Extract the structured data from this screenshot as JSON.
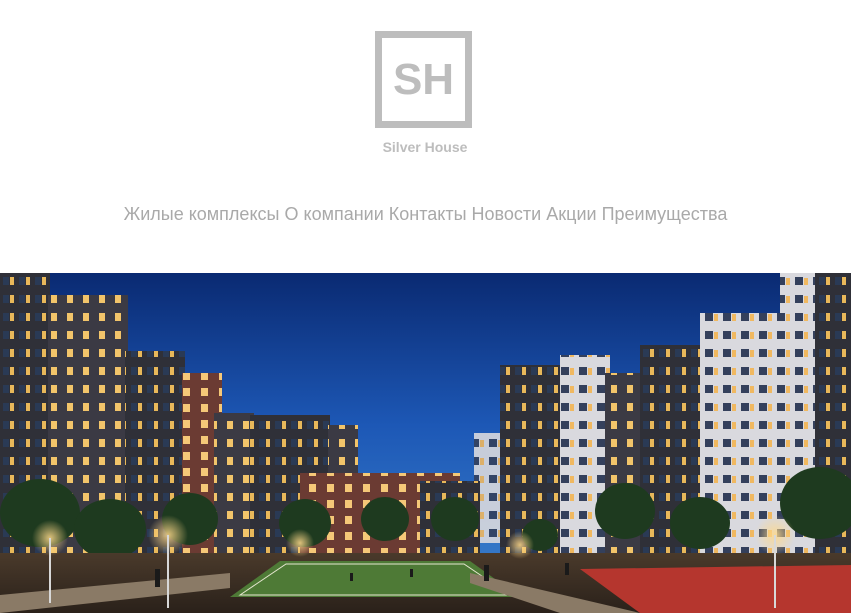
{
  "brand": {
    "logo_mark": "SH",
    "name": "Silver House",
    "color": "#bdbdbd"
  },
  "nav": {
    "items": [
      {
        "label": "Жилые комплексы"
      },
      {
        "label": "О компании"
      },
      {
        "label": "Контакты"
      },
      {
        "label": "Новости"
      },
      {
        "label": "Акции"
      },
      {
        "label": "Преимущества"
      }
    ],
    "color": "#a9a9a9"
  },
  "hero": {
    "image": "residential-complex-night-render"
  }
}
